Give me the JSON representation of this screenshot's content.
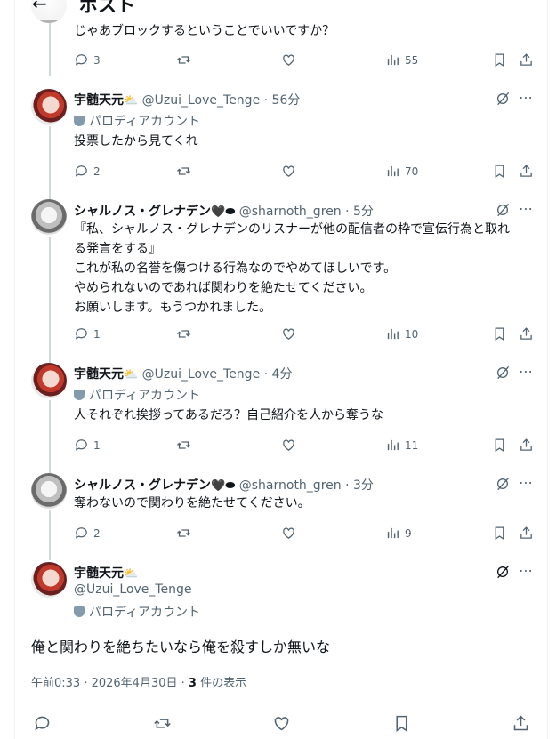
{
  "header": {
    "back_icon": "arrow-left-icon",
    "title": "ポスト"
  },
  "top_fragment": {
    "text": "じゃあブロックするということでいいですか？"
  },
  "top_actions": {
    "replies": "3",
    "views": "55"
  },
  "posts": [
    {
      "name": "宇髄天元",
      "handle": "@Uzui_Love_Tenge",
      "time": "· 56分",
      "parody": "パロディアカウント",
      "lines": [
        "投票したから見てくれ"
      ],
      "replies": "2",
      "views": "70"
    },
    {
      "name": "シャルノス・グレナデン",
      "handle": "@sharnoth_gren",
      "time": "· 5分",
      "parody": "",
      "lines": [
        "『私、シャルノス・グレナデンのリスナーが他の配信者の枠で宣伝行為と取れ",
        "る発言をする』",
        "これが私の名誉を傷つける行為なのでやめてほしいです。",
        "やめられないのであれば関わりを絶たせてください。",
        "お願いします。もうつかれました。"
      ],
      "replies": "1",
      "views": "10"
    },
    {
      "name": "宇髄天元",
      "handle": "@Uzui_Love_Tenge",
      "time": "· 4分",
      "parody": "パロディアカウント",
      "lines": [
        "人それぞれ挨拶ってあるだろ？自己紹介を人から奪うな"
      ],
      "replies": "1",
      "views": "11"
    },
    {
      "name": "シャルノス・グレナデン",
      "handle": "@sharnoth_gren",
      "time": "· 3分",
      "parody": "",
      "lines": [
        "奪わないので関わりを絶たせてください。"
      ],
      "replies": "2",
      "views": "9"
    }
  ],
  "main_post": {
    "name": "宇髄天元",
    "handle": "@Uzui_Love_Tenge",
    "parody": "パロディアカウント",
    "text": "俺と関わりを絶ちたいなら俺を殺すしか無いな",
    "time": "午前0:33 · 2026年4月30日 · ",
    "view_count": "3",
    "view_label": " 件の表示"
  },
  "colors": {
    "text": "#0f1419",
    "muted": "#536471",
    "border": "#eff3f4",
    "thread": "#cfd9de"
  }
}
